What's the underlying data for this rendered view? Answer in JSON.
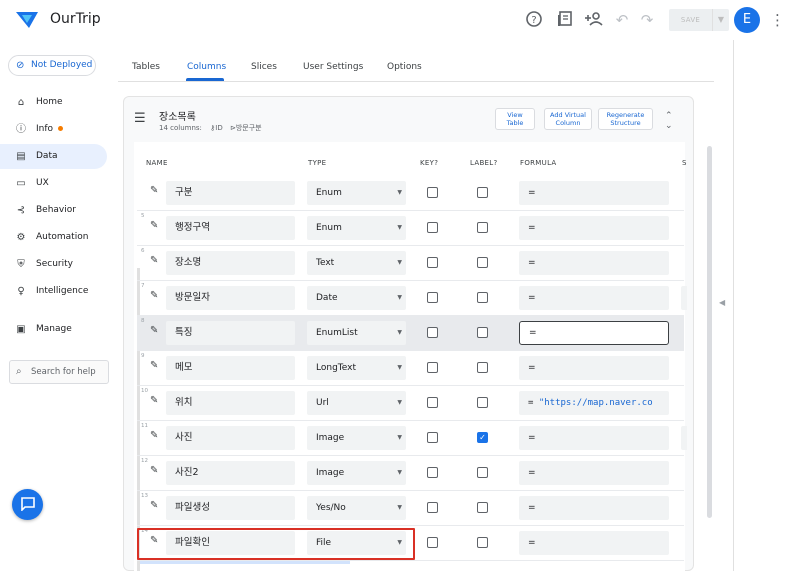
{
  "app": {
    "name": "OurTrip",
    "avatar_letter": "E"
  },
  "toolbar": {
    "save_label": "SAVE",
    "icons": [
      "help-icon",
      "preview-icon",
      "add-person-icon",
      "undo-icon",
      "redo-icon"
    ]
  },
  "deploy_status": "Not Deployed",
  "sidebar": {
    "items": [
      {
        "label": "Home",
        "icon": "home-icon"
      },
      {
        "label": "Info",
        "icon": "info-icon"
      },
      {
        "label": "Data",
        "icon": "data-icon"
      },
      {
        "label": "UX",
        "icon": "ux-icon"
      },
      {
        "label": "Behavior",
        "icon": "behavior-icon"
      },
      {
        "label": "Automation",
        "icon": "automation-icon"
      },
      {
        "label": "Security",
        "icon": "security-icon"
      },
      {
        "label": "Intelligence",
        "icon": "intelligence-icon"
      },
      {
        "label": "Manage",
        "icon": "manage-icon"
      }
    ],
    "help_placeholder": "Search for help"
  },
  "tabs": [
    "Tables",
    "Columns",
    "Slices",
    "User Settings",
    "Options"
  ],
  "table": {
    "name": "장소목록",
    "columns_count": "14 columns:",
    "key_col": "ID",
    "label_col": "방문구분",
    "buttons": {
      "view_table": [
        "View",
        "Table"
      ],
      "add_virtual": [
        "Add Virtual",
        "Column"
      ],
      "regenerate": [
        "Regenerate",
        "Structure"
      ]
    }
  },
  "column_headers": {
    "name": "NAME",
    "type": "TYPE",
    "key": "KEY?",
    "label": "LABEL?",
    "formula": "FORMULA",
    "extra": "S"
  },
  "rows": [
    {
      "num": "",
      "name": "구분",
      "type": "Enum",
      "key": false,
      "label": false,
      "formula": "="
    },
    {
      "num": "5",
      "name": "행정구역",
      "type": "Enum",
      "key": false,
      "label": false,
      "formula": "="
    },
    {
      "num": "6",
      "name": "장소명",
      "type": "Text",
      "key": false,
      "label": false,
      "formula": "="
    },
    {
      "num": "7",
      "name": "방문일자",
      "type": "Date",
      "key": false,
      "label": false,
      "formula": "="
    },
    {
      "num": "8",
      "name": "특징",
      "type": "EnumList",
      "key": false,
      "label": false,
      "formula": "="
    },
    {
      "num": "9",
      "name": "메모",
      "type": "LongText",
      "key": false,
      "label": false,
      "formula": "="
    },
    {
      "num": "10",
      "name": "위치",
      "type": "Url",
      "key": false,
      "label": false,
      "formula": "= ",
      "formula_str": "\"https://map.naver.co"
    },
    {
      "num": "11",
      "name": "사진",
      "type": "Image",
      "key": false,
      "label": true,
      "formula": "="
    },
    {
      "num": "12",
      "name": "사진2",
      "type": "Image",
      "key": false,
      "label": false,
      "formula": "="
    },
    {
      "num": "13",
      "name": "파일생성",
      "type": "Yes/No",
      "key": false,
      "label": false,
      "formula": "="
    },
    {
      "num": "14",
      "name": "파일확인",
      "type": "File",
      "key": false,
      "label": false,
      "formula": "="
    }
  ],
  "colors": {
    "accent": "#1a73e8",
    "highlight_outline": "#d93025",
    "active_nav": "#e8f0fe"
  }
}
